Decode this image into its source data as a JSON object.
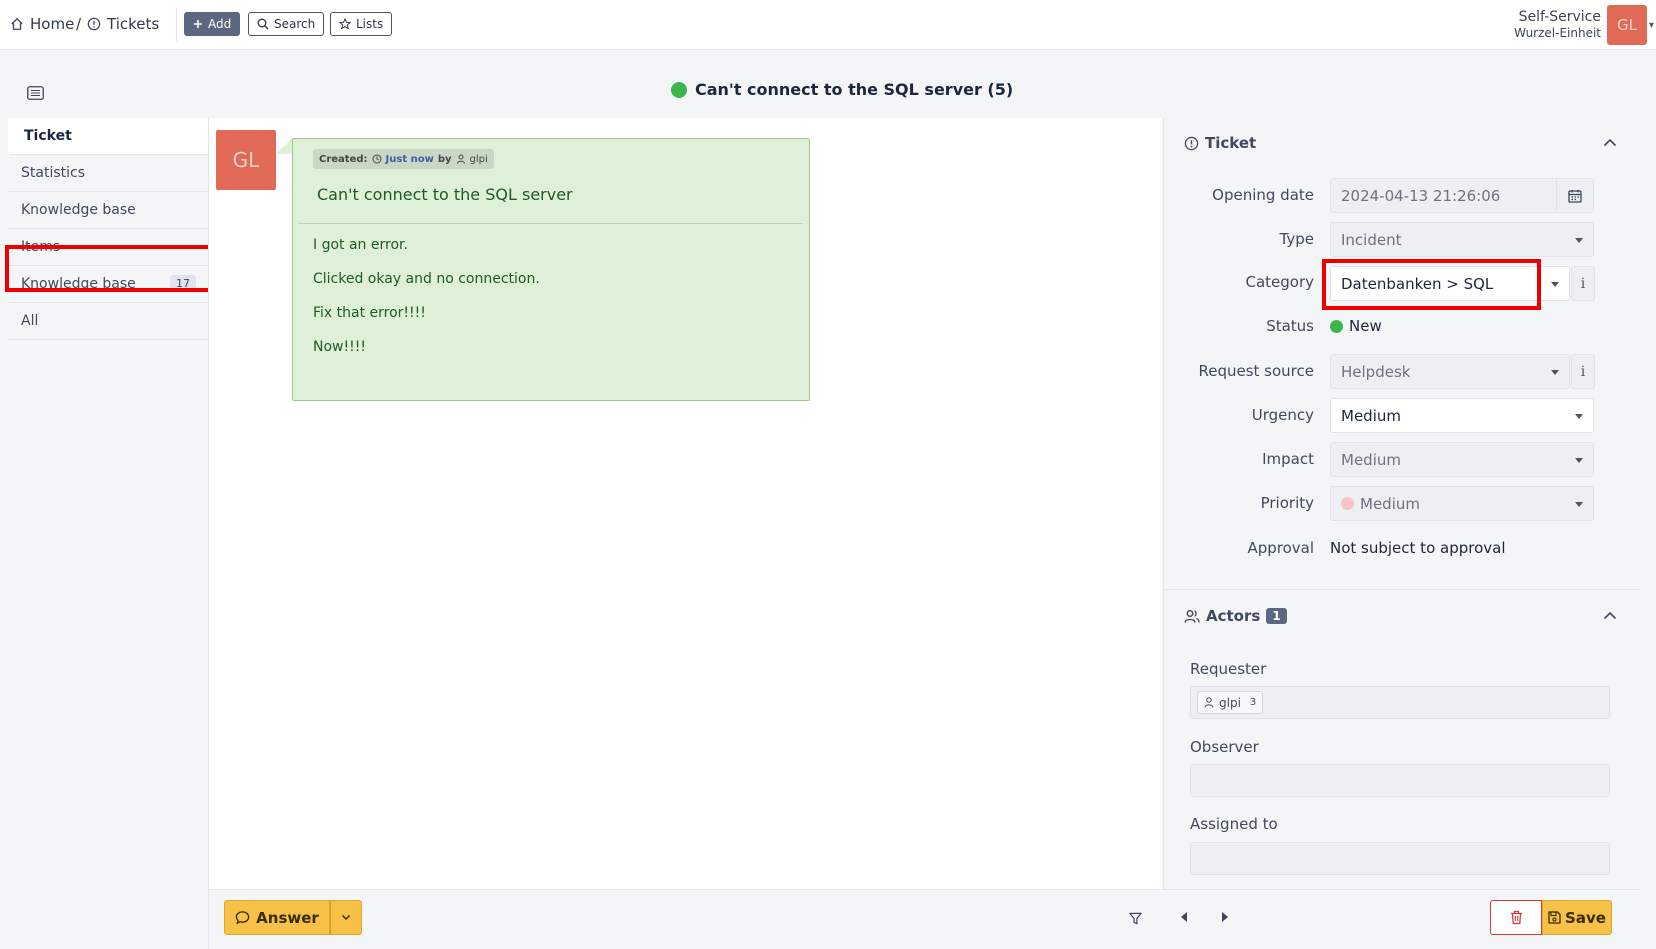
{
  "header": {
    "breadcrumb_home": "Home",
    "breadcrumb_sep": "/",
    "breadcrumb_tickets": "Tickets",
    "add_label": "Add",
    "search_label": "Search",
    "lists_label": "Lists",
    "user_profile": "Self-Service",
    "user_entity": "Wurzel-Einheit",
    "user_initials": "GL"
  },
  "title": {
    "text": "Can't connect to the SQL server (5)",
    "status_color": "#3cb54a"
  },
  "leftnav": {
    "items": [
      {
        "label": "Ticket",
        "active": true
      },
      {
        "label": "Statistics"
      },
      {
        "label": "Knowledge base"
      },
      {
        "label": "Items"
      },
      {
        "label": "Knowledge base",
        "badge": "17"
      },
      {
        "label": "All"
      }
    ]
  },
  "timeline": {
    "avatar_initials": "GL",
    "meta_created": "Created:",
    "meta_when": "Just now",
    "meta_by": "by",
    "meta_user": "glpi",
    "item_title": "Can't connect to the SQL server",
    "lines": [
      "I got an error.",
      "Clicked okay and no connection.",
      "Fix that error!!!!",
      "Now!!!!"
    ],
    "answer_label": "Answer"
  },
  "ticket": {
    "section_title": "Ticket",
    "fields": {
      "opening_date": {
        "label": "Opening date",
        "value": "2024-04-13 21:26:06"
      },
      "type": {
        "label": "Type",
        "value": "Incident"
      },
      "category": {
        "label": "Category",
        "value": "Datenbanken > SQL"
      },
      "status": {
        "label": "Status",
        "value": "New"
      },
      "request_source": {
        "label": "Request source",
        "value": "Helpdesk"
      },
      "urgency": {
        "label": "Urgency",
        "value": "Medium"
      },
      "impact": {
        "label": "Impact",
        "value": "Medium"
      },
      "priority": {
        "label": "Priority",
        "value": "Medium"
      },
      "approval": {
        "label": "Approval",
        "value": "Not subject to approval"
      }
    },
    "info_glyph": "i"
  },
  "actors": {
    "section_title": "Actors",
    "count": "1",
    "requester_label": "Requester",
    "requester_name": "glpi",
    "requester_count": "3",
    "observer_label": "Observer",
    "assigned_label": "Assigned to"
  },
  "footer": {
    "save_label": "Save"
  },
  "colors": {
    "accent_yellow": "#f7c046",
    "brand_slate": "#5a6882",
    "avatar": "#e06a55",
    "highlight_red": "#e00000"
  }
}
